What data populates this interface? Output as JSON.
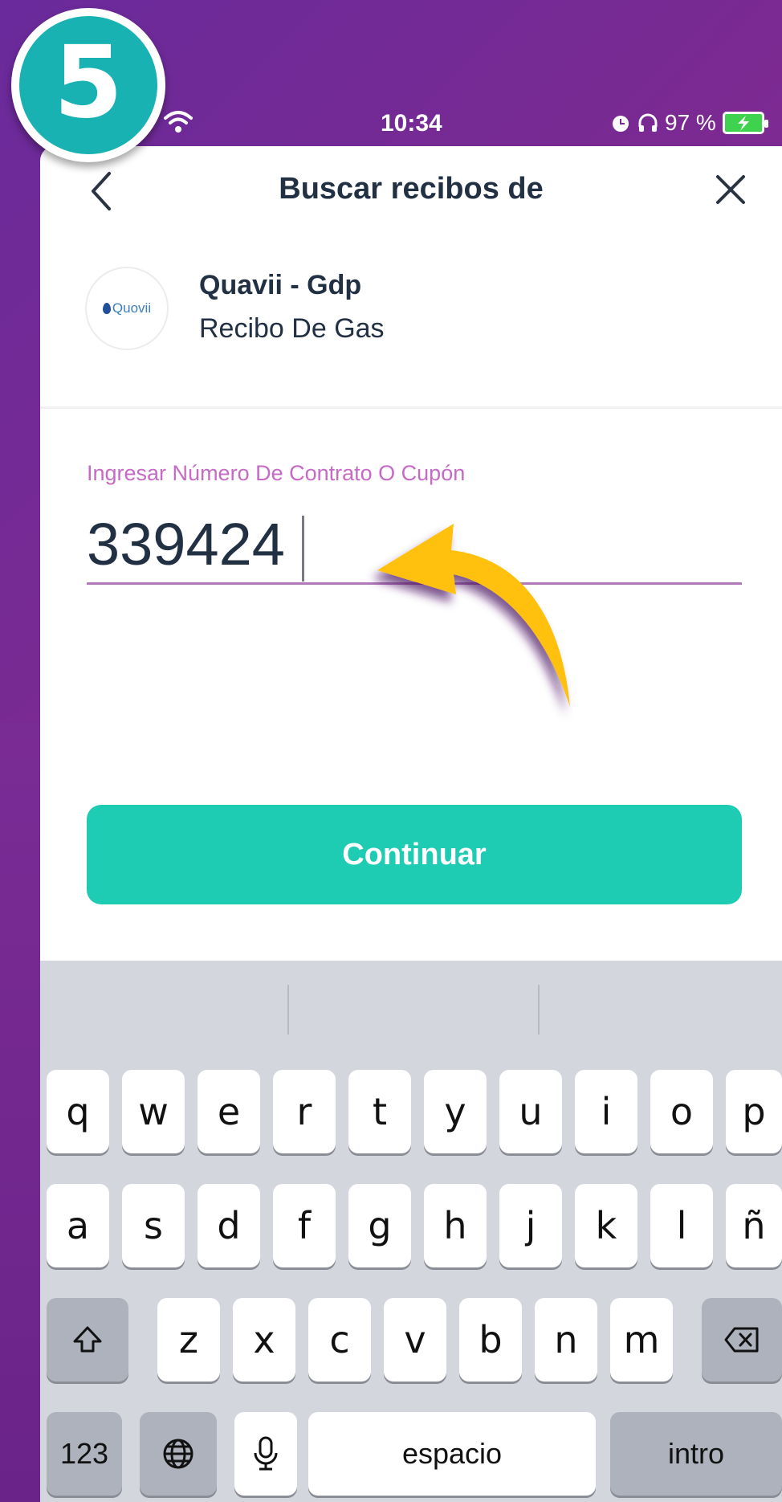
{
  "step_badge": "5",
  "status_bar": {
    "time": "10:34",
    "battery_text": "97 %"
  },
  "header": {
    "title": "Buscar recibos de"
  },
  "provider": {
    "logo_text": "Quovii",
    "name": "Quavii - Gdp",
    "type": "Recibo De Gas"
  },
  "form": {
    "label": "Ingresar Número De Contrato O Cupón",
    "value": "339424"
  },
  "continue_label": "Continuar",
  "keyboard": {
    "row1": [
      "q",
      "w",
      "e",
      "r",
      "t",
      "y",
      "u",
      "i",
      "o",
      "p"
    ],
    "row2": [
      "a",
      "s",
      "d",
      "f",
      "g",
      "h",
      "j",
      "k",
      "l",
      "ñ"
    ],
    "row3": [
      "z",
      "x",
      "c",
      "v",
      "b",
      "n",
      "m"
    ],
    "numbers_label": "123",
    "space_label": "espacio",
    "return_label": "intro"
  },
  "colors": {
    "accent": "#1ecbb3",
    "badge": "#19b2b3",
    "label": "#c76ac7",
    "background": "#7a2a92",
    "arrow": "#ffc107"
  }
}
